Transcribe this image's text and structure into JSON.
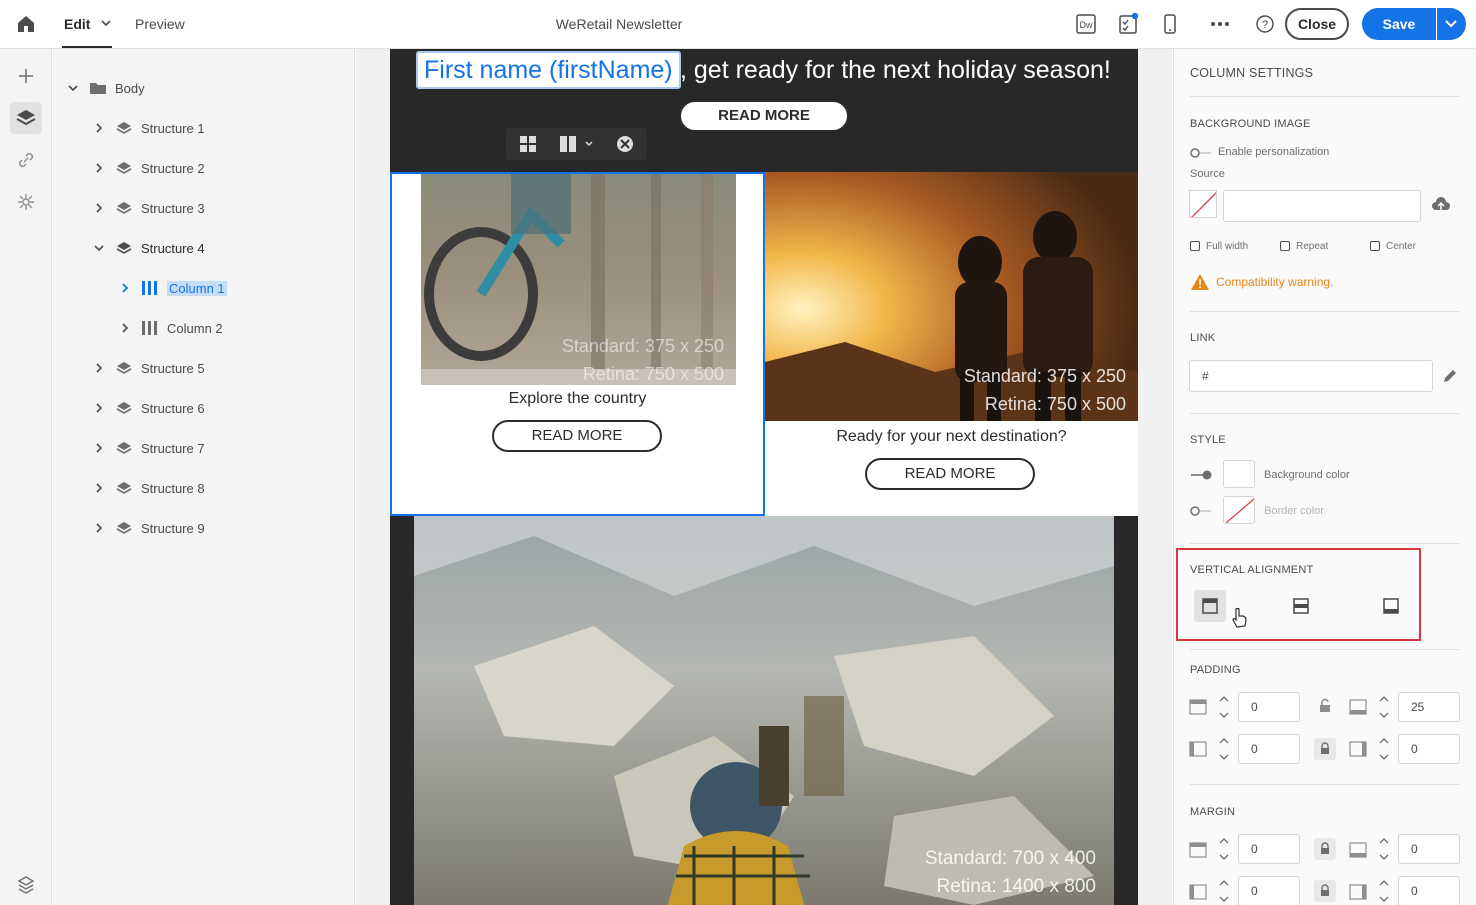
{
  "topbar": {
    "tab_edit": "Edit",
    "tab_preview": "Preview",
    "title": "WeRetail Newsletter",
    "close_label": "Close",
    "save_label": "Save",
    "dw_label": "Dw"
  },
  "tree": {
    "root": "Body",
    "structures": [
      "Structure 1",
      "Structure 2",
      "Structure 3",
      "Structure 4",
      "Structure 5",
      "Structure 6",
      "Structure 7",
      "Structure 8",
      "Structure 9"
    ],
    "columns": [
      "Column 1",
      "Column 2"
    ]
  },
  "email": {
    "firstname_token": "First name (firstName)",
    "headline_rest": ", get ready for the next holiday season!",
    "read_more": "READ MORE",
    "col1_text": "Explore the country",
    "col2_text": "Ready for your next destination?",
    "img1_standard": "Standard: 375 x 250",
    "img1_retina": "Retina: 750 x 500",
    "img2_standard": "Standard: 375 x 250",
    "img2_retina": "Retina: 750 x 500",
    "img3_standard": "Standard: 700 x 400",
    "img3_retina": "Retina: 1400 x 800"
  },
  "panel": {
    "title": "COLUMN SETTINGS",
    "bg_image_label": "BACKGROUND IMAGE",
    "enable_personalization": "Enable personalization",
    "source_label": "Source",
    "source_value": "",
    "full_width": "Full width",
    "repeat": "Repeat",
    "center": "Center",
    "compat_warning": "Compatibility warning.",
    "link_label": "LINK",
    "link_value": "#",
    "style_label": "STYLE",
    "background_color": "Background color",
    "border_color": "Border color",
    "vertical_alignment": "VERTICAL ALIGNMENT",
    "padding_label": "PADDING",
    "padding": {
      "top": "0",
      "bottom": "25",
      "left": "0",
      "right": "0"
    },
    "margin_label": "MARGIN",
    "margin": {
      "top": "0",
      "bottom": "0",
      "left": "0",
      "right": "0"
    }
  },
  "colors": {
    "accent": "#1473e6",
    "warning": "#e68619",
    "highlight": "#d7373f"
  }
}
